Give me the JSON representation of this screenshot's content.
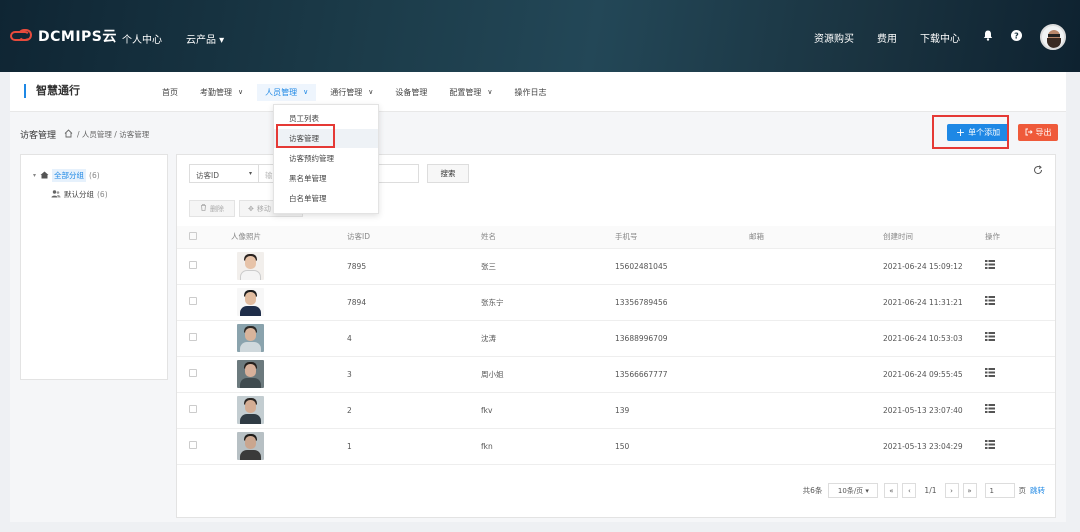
{
  "top": {
    "logo": "DCMIPS云",
    "nav": [
      "个人中心",
      "云产品 ▾"
    ],
    "right_links": [
      "资源购买",
      "费用",
      "下载中心"
    ],
    "icons": [
      "bell-icon",
      "help-icon"
    ]
  },
  "app": {
    "title": "智慧通行",
    "nav": [
      {
        "label": "首页",
        "chev": ""
      },
      {
        "label": "考勤管理",
        "chev": "∨"
      },
      {
        "label": "人员管理",
        "chev": "∨"
      },
      {
        "label": "通行管理",
        "chev": "∨"
      },
      {
        "label": "设备管理",
        "chev": ""
      },
      {
        "label": "配置管理",
        "chev": "∨"
      },
      {
        "label": "操作日志",
        "chev": ""
      }
    ]
  },
  "breadcrumb": {
    "title": "访客管理",
    "path": "/ 人员管理 / 访客管理"
  },
  "actions": {
    "add": "单个添加",
    "export": "导出"
  },
  "tree": {
    "root": {
      "label": "全部分组",
      "count": "(6)"
    },
    "child": {
      "label": "默认分组",
      "count": "(6)"
    }
  },
  "filter": {
    "field": "访客ID",
    "placeholder": "输",
    "search": "搜索"
  },
  "toolbar": {
    "delete": "删除",
    "move": "移动"
  },
  "dropdown": [
    "员工列表",
    "访客管理",
    "访客预约管理",
    "黑名单管理",
    "白名单管理"
  ],
  "table": {
    "headers": [
      "人像照片",
      "访客ID",
      "姓名",
      "手机号",
      "邮箱",
      "创建时间",
      "操作"
    ],
    "rows": [
      {
        "id": "7895",
        "name": "张三",
        "phone": "15602481045",
        "email": "",
        "created": "2021-06-24 15:09:12"
      },
      {
        "id": "7894",
        "name": "张东宁",
        "phone": "13356789456",
        "email": "",
        "created": "2021-06-24 11:31:21"
      },
      {
        "id": "4",
        "name": "沈涛",
        "phone": "13688996709",
        "email": "",
        "created": "2021-06-24 10:53:03"
      },
      {
        "id": "3",
        "name": "周小姐",
        "phone": "13566667777",
        "email": "",
        "created": "2021-06-24 09:55:45"
      },
      {
        "id": "2",
        "name": "fkv",
        "phone": "139",
        "email": "",
        "created": "2021-05-13 23:07:40"
      },
      {
        "id": "1",
        "name": "fkn",
        "phone": "150",
        "email": "",
        "created": "2021-05-13 23:04:29"
      }
    ]
  },
  "pager": {
    "total": "共6条",
    "size": "10条/页 ▾",
    "pages": "1/1",
    "input": "1",
    "page_unit": "页",
    "jump": "跳转"
  },
  "colors": {
    "accent": "#1e88e5",
    "export": "#ef5a3a",
    "highlight": "#e53935"
  }
}
